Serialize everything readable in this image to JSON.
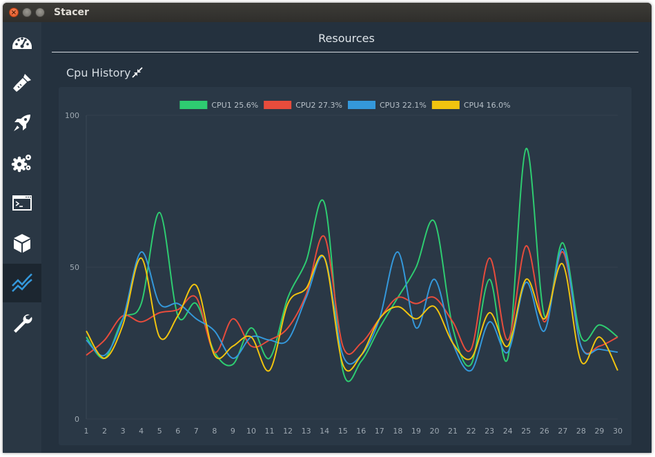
{
  "window": {
    "title": "Stacer"
  },
  "sidebar": {
    "items": [
      {
        "name": "dashboard",
        "icon": "dashboard-gauge-icon"
      },
      {
        "name": "system-cleaner",
        "icon": "broom-icon"
      },
      {
        "name": "startup-apps",
        "icon": "rocket-icon"
      },
      {
        "name": "services",
        "icon": "gears-icon"
      },
      {
        "name": "processes",
        "icon": "terminal-window-icon"
      },
      {
        "name": "uninstaller",
        "icon": "package-box-icon"
      },
      {
        "name": "resources",
        "icon": "line-chart-icon",
        "active": true
      },
      {
        "name": "settings",
        "icon": "wrench-icon"
      }
    ]
  },
  "main": {
    "title": "Resources",
    "section_title": "Cpu History"
  },
  "colors": {
    "cpu1": "#2ecc71",
    "cpu2": "#e74c3c",
    "cpu3": "#3498db",
    "cpu4": "#f1c40f",
    "background": "#24313e",
    "card": "#2a3846"
  },
  "chart_data": {
    "type": "line",
    "x": [
      1,
      2,
      3,
      4,
      5,
      6,
      7,
      8,
      9,
      10,
      11,
      12,
      13,
      14,
      15,
      16,
      17,
      18,
      19,
      20,
      21,
      22,
      23,
      24,
      25,
      26,
      27,
      28,
      29,
      30
    ],
    "ylim": [
      0,
      100
    ],
    "yticks": [
      0,
      50,
      100
    ],
    "legend_position": "top-center",
    "grid": true,
    "series": [
      {
        "name": "CPU1 25.6%",
        "color": "#2ecc71",
        "values": [
          27,
          20,
          33,
          38,
          68,
          34,
          38,
          22,
          18,
          30,
          20,
          40,
          52,
          71,
          16,
          19,
          30,
          40,
          50,
          65,
          30,
          18,
          46,
          20,
          89,
          34,
          58,
          27,
          31,
          27
        ]
      },
      {
        "name": "CPU2 27.3%",
        "color": "#e74c3c",
        "values": [
          21,
          26,
          34,
          32,
          35,
          36,
          40,
          22,
          33,
          24,
          26,
          30,
          41,
          60,
          24,
          25,
          33,
          40,
          38,
          40,
          32,
          23,
          53,
          26,
          57,
          32,
          55,
          24,
          24,
          27
        ]
      },
      {
        "name": "CPU3 22.1%",
        "color": "#3498db",
        "values": [
          26,
          21,
          33,
          55,
          38,
          38,
          33,
          29,
          20,
          27,
          26,
          26,
          40,
          53,
          21,
          21,
          33,
          55,
          30,
          46,
          25,
          16,
          32,
          22,
          45,
          29,
          56,
          24,
          23,
          22
        ]
      },
      {
        "name": "CPU4 16.0%",
        "color": "#f1c40f",
        "values": [
          29,
          20,
          31,
          53,
          27,
          34,
          44,
          21,
          24,
          27,
          16,
          38,
          43,
          53,
          18,
          21,
          33,
          37,
          33,
          37,
          25,
          20,
          35,
          24,
          46,
          33,
          51,
          19,
          27,
          16
        ]
      }
    ]
  }
}
